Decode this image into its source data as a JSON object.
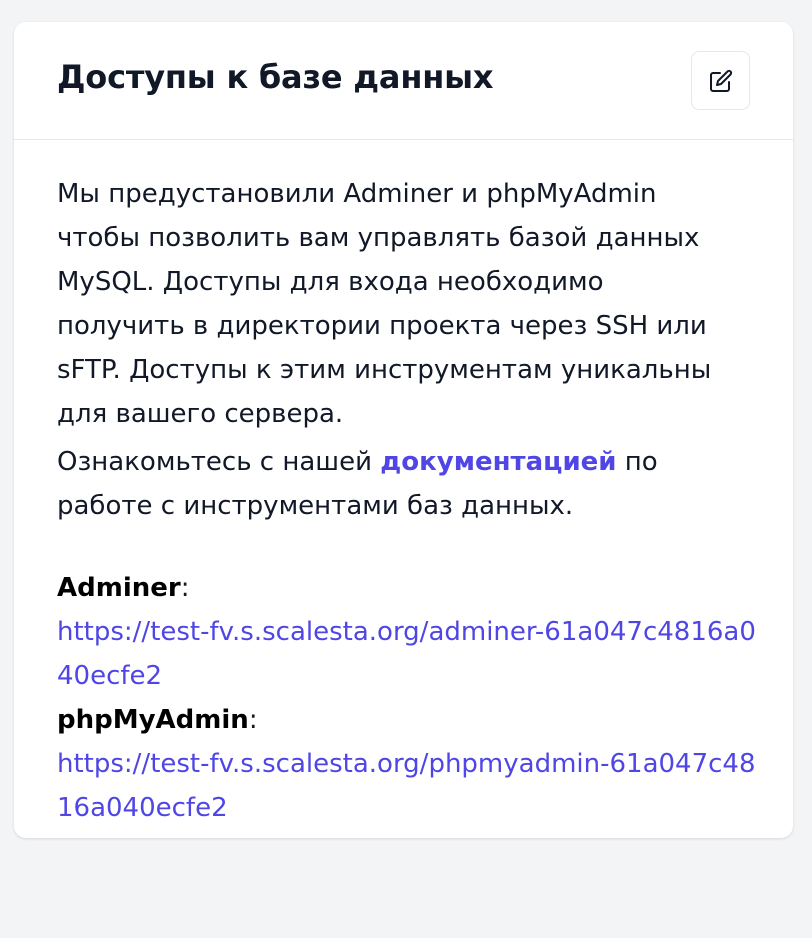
{
  "card": {
    "title": "Доступы к базе данных",
    "edit_icon": "pencil-square-icon"
  },
  "description": {
    "text": "Мы предустановили Adminer и phpMyAdmin чтобы позволить вам управлять базой данных MySQL. Доступы для входа необходимо получить в директории проекта через SSH или sFTP. Доступы к этим инструментам уникальны для вашего сервера.",
    "doc_prefix": "Ознакомьтесь с нашей ",
    "doc_link": "документацией",
    "doc_suffix": " по работе с инструментами баз данных."
  },
  "tools": [
    {
      "label": "Adminer",
      "separator": ":",
      "url": "https://test-fv.s.scalesta.org/adminer-61a047c4816a040ecfe2"
    },
    {
      "label": "phpMyAdmin",
      "separator": ":",
      "url": "https://test-fv.s.scalesta.org/phpmyadmin-61a047c4816a040ecfe2"
    }
  ],
  "colors": {
    "link": "#4f46e5",
    "title": "#111827",
    "background": "#f3f4f6",
    "card": "#ffffff",
    "border": "#e5e7eb"
  }
}
